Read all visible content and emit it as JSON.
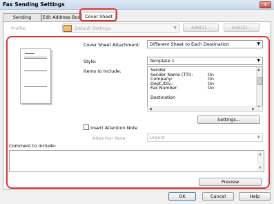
{
  "window": {
    "title": "Fax Sending Settings",
    "close_glyph": "✕"
  },
  "tabs": [
    {
      "label": "Sending Settings",
      "active": false
    },
    {
      "label": "Edit Address Boo",
      "active": false
    },
    {
      "label": "Cover Sheet",
      "active": true
    }
  ],
  "profile": {
    "label": "Profile:",
    "value": "Default Settings",
    "add_label": "Add(1)...",
    "edit_label": "Edit(2)..."
  },
  "cover_sheet": {
    "attachment_label": "Cover Sheet Attachment:",
    "attachment_value": "Different Sheet to Each Destination",
    "style_label": "Style:",
    "style_value": "Template 1",
    "items_label": "Items to Include:",
    "items": [
      {
        "name": "Sender",
        "value": ""
      },
      {
        "name": "Sender Name (TTI):",
        "value": "On"
      },
      {
        "name": "Company:",
        "value": "On"
      },
      {
        "name": "Dept./Div.:",
        "value": "On"
      },
      {
        "name": "Fax Number:",
        "value": "On"
      },
      {
        "name": "",
        "value": ""
      },
      {
        "name": "Destination",
        "value": ""
      }
    ],
    "settings_button": "Settings...",
    "attention_checkbox_label": "Insert Attention Note",
    "attention_checked": false,
    "attention_note_label": "Attention Note:",
    "attention_note_value": "Urgent",
    "comment_label": "Comment to Include:",
    "comment_value": "",
    "preview_button": "Preview"
  },
  "footer": {
    "ok": "OK",
    "cancel": "Cancel",
    "help": "Help"
  },
  "colors": {
    "highlight": "#e03030",
    "titlebar": "#c9daf0",
    "close": "#c7503a"
  },
  "icons": [
    "close-icon",
    "chevron-down-icon",
    "profile-icon",
    "scroll-up-icon",
    "scroll-down-icon",
    "scroll-left-icon",
    "scroll-right-icon"
  ]
}
